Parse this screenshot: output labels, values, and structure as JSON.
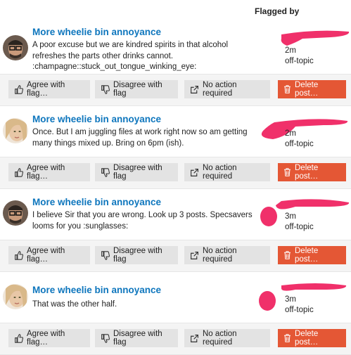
{
  "header": {
    "flagged_by": "Flagged by"
  },
  "actions": {
    "agree": "Agree with flag…",
    "disagree": "Disagree with flag",
    "no_action": "No action required",
    "delete": "Delete post…"
  },
  "colors": {
    "link": "#0e76bd",
    "delete_button": "#e45735",
    "redaction": "#f0306a"
  },
  "posts": [
    {
      "title": "More wheelie bin annoyance",
      "body": "A poor excuse but we are kindred spirits in that alcohol refreshes the parts other drinks cannot. :champagne::stuck_out_tongue_winking_eye:",
      "flag_time": "2m",
      "flag_reason": "off-topic",
      "avatar": "man-with-glasses"
    },
    {
      "title": "More wheelie bin annoyance",
      "body": "Once. But I am juggling files at work right now so am getting many things mixed up. Bring on 6pm (ish).",
      "flag_time": "2m",
      "flag_reason": "off-topic",
      "avatar": "woman-blonde"
    },
    {
      "title": "More wheelie bin annoyance",
      "body": "I believe Sir that you are wrong. Look up 3 posts. Specsavers looms for you :sunglasses:",
      "flag_time": "3m",
      "flag_reason": "off-topic",
      "avatar": "man-with-glasses"
    },
    {
      "title": "More wheelie bin annoyance",
      "body": "That was the other half.",
      "flag_time": "3m",
      "flag_reason": "off-topic",
      "avatar": "woman-blonde"
    }
  ]
}
